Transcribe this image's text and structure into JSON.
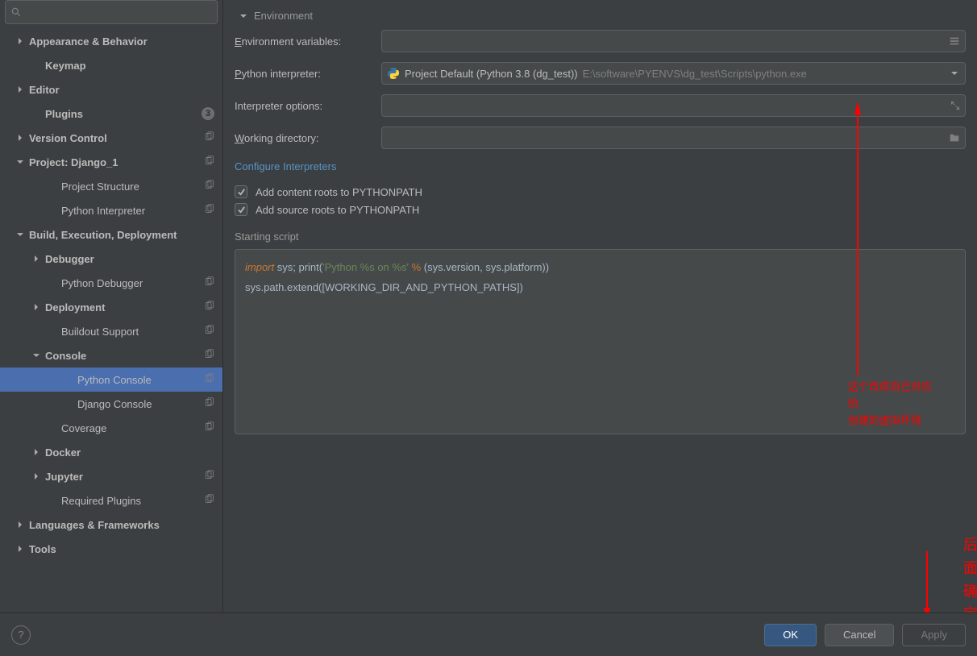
{
  "sidebar": {
    "search_placeholder": "",
    "items": [
      {
        "label": "Appearance & Behavior",
        "level": 1,
        "arrow": "right",
        "badge": null,
        "copy": false
      },
      {
        "label": "Keymap",
        "level": 2,
        "arrow": null,
        "badge": null,
        "copy": false
      },
      {
        "label": "Editor",
        "level": 1,
        "arrow": "right",
        "badge": null,
        "copy": false
      },
      {
        "label": "Plugins",
        "level": 2,
        "arrow": null,
        "badge": "3",
        "copy": false
      },
      {
        "label": "Version Control",
        "level": 1,
        "arrow": "right",
        "badge": null,
        "copy": true
      },
      {
        "label": "Project: Django_1",
        "level": 1,
        "arrow": "down",
        "badge": null,
        "copy": true
      },
      {
        "label": "Project Structure",
        "level": 3,
        "arrow": null,
        "badge": null,
        "copy": true
      },
      {
        "label": "Python Interpreter",
        "level": 3,
        "arrow": null,
        "badge": null,
        "copy": true
      },
      {
        "label": "Build, Execution, Deployment",
        "level": 1,
        "arrow": "down",
        "badge": null,
        "copy": false
      },
      {
        "label": "Debugger",
        "level": 2,
        "arrow": "right",
        "badge": null,
        "copy": false
      },
      {
        "label": "Python Debugger",
        "level": 3,
        "arrow": null,
        "badge": null,
        "copy": true
      },
      {
        "label": "Deployment",
        "level": 2,
        "arrow": "right",
        "badge": null,
        "copy": true
      },
      {
        "label": "Buildout Support",
        "level": 3,
        "arrow": null,
        "badge": null,
        "copy": true
      },
      {
        "label": "Console",
        "level": 2,
        "arrow": "down",
        "badge": null,
        "copy": true
      },
      {
        "label": "Python Console",
        "level": 4,
        "arrow": null,
        "badge": null,
        "copy": true,
        "selected": true
      },
      {
        "label": "Django Console",
        "level": 4,
        "arrow": null,
        "badge": null,
        "copy": true
      },
      {
        "label": "Coverage",
        "level": 3,
        "arrow": null,
        "badge": null,
        "copy": true
      },
      {
        "label": "Docker",
        "level": 2,
        "arrow": "right",
        "badge": null,
        "copy": false
      },
      {
        "label": "Jupyter",
        "level": 2,
        "arrow": "right",
        "badge": null,
        "copy": true
      },
      {
        "label": "Required Plugins",
        "level": 3,
        "arrow": null,
        "badge": null,
        "copy": true
      },
      {
        "label": "Languages & Frameworks",
        "level": 1,
        "arrow": "right",
        "badge": null,
        "copy": false
      },
      {
        "label": "Tools",
        "level": 1,
        "arrow": "right",
        "badge": null,
        "copy": false
      }
    ]
  },
  "content": {
    "section_title": "Environment",
    "env_vars_label": "Environment variables:",
    "env_vars_label_u": "E",
    "env_vars_value": "",
    "interp_label": "Python interpreter:",
    "interp_label_u": "P",
    "interp_value": "Project Default (Python 3.8 (dg_test))",
    "interp_path": "E:\\software\\PYENVS\\dg_test\\Scripts\\python.exe",
    "interp_opts_label": "Interpreter options:",
    "interp_opts_value": "",
    "workdir_label": "Working directory:",
    "workdir_label_u": "W",
    "workdir_value": "",
    "configure_link": "Configure Interpreters",
    "checkbox1": "Add content roots to PYTHONPATH",
    "checkbox1_checked": true,
    "checkbox2": "Add source roots to PYTHONPATH",
    "checkbox2_checked": true,
    "start_label": "Starting script",
    "script": {
      "kw": "import",
      "line1_rest": " sys; print(",
      "str": "'Python %s on %s'",
      "op": " % ",
      "line1_end": "(sys.version, sys.platform))",
      "line2": "sys.path.extend([WORKING_DIR_AND_PYTHON_PATHS])"
    }
  },
  "footer": {
    "ok": "OK",
    "cancel": "Cancel",
    "apply": "Apply"
  },
  "annotations": {
    "text1": "这个改成自己对应的\n创建的虚拟环境",
    "text1_l1": "这个改成自己对应",
    "text1_l2": "的",
    "text1_l3": "创建的虚拟环境",
    "text2": "后面确定"
  }
}
